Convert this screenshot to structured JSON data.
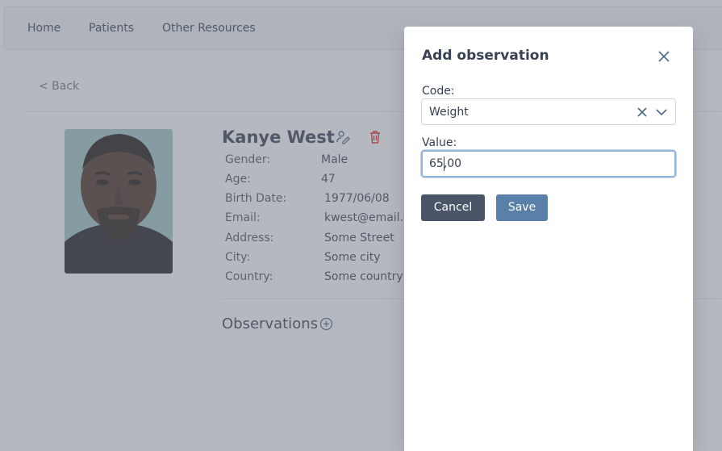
{
  "nav": {
    "items": [
      "Home",
      "Patients",
      "Other Resources"
    ]
  },
  "back_link": "< Back",
  "patient": {
    "name": "Kanye West",
    "fields": [
      {
        "label": "Gender:",
        "value": "Male"
      },
      {
        "label": "Age:",
        "value": "47"
      },
      {
        "label": "Birth Date:",
        "value": "1977/06/08"
      },
      {
        "label": "Email:",
        "value": "kwest@email.c"
      },
      {
        "label": "Address:",
        "value": "Some Street"
      },
      {
        "label": "City:",
        "value": "Some city"
      },
      {
        "label": "Country:",
        "value": "Some country"
      }
    ]
  },
  "observations": {
    "title": "Observations"
  },
  "modal": {
    "title": "Add observation",
    "code_label": "Code:",
    "code_value": "Weight",
    "value_label": "Value:",
    "value_input": "65,00",
    "cancel_label": "Cancel",
    "save_label": "Save"
  },
  "colors": {
    "overlay": "#6b7280",
    "delete_icon": "#dc2626",
    "cancel_button": "#4a5568",
    "save_button": "#5a7fa8",
    "input_focus": "#93b4d8"
  }
}
